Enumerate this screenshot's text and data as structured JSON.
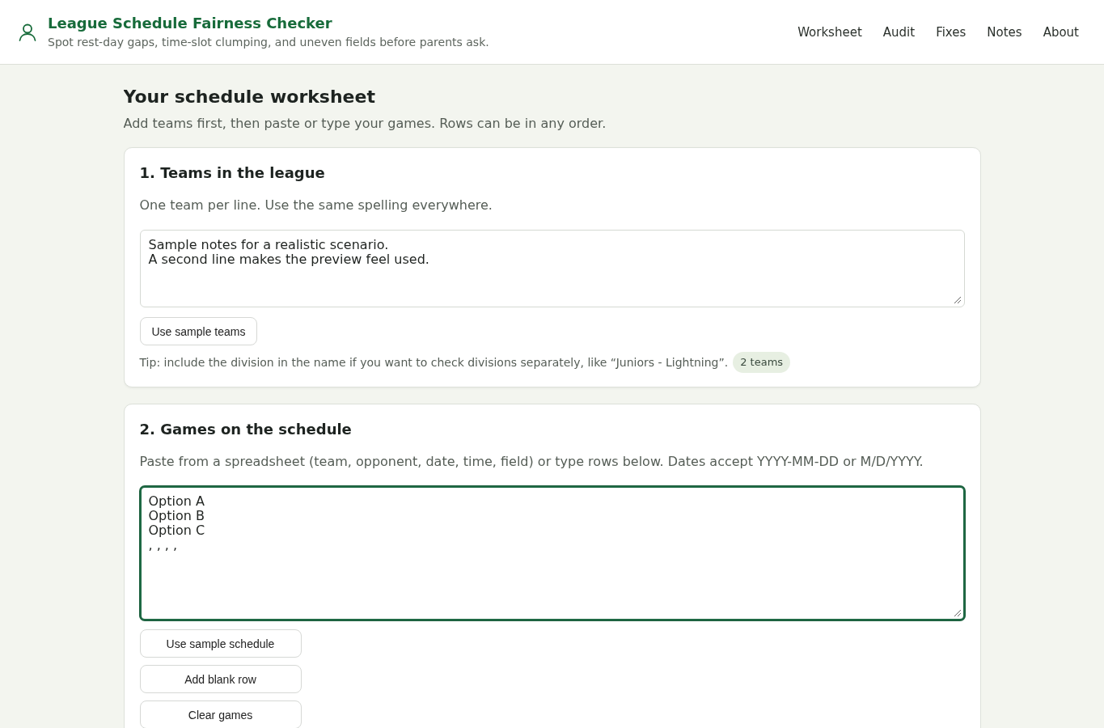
{
  "header": {
    "title": "League Schedule Fairness Checker",
    "subtitle": "Spot rest-day gaps, time-slot clumping, and uneven fields before parents ask.",
    "nav": [
      "Worksheet",
      "Audit",
      "Fixes",
      "Notes",
      "About"
    ]
  },
  "page": {
    "title": "Your schedule worksheet",
    "intro": "Add teams first, then paste or type your games. Rows can be in any order."
  },
  "sections": [
    {
      "title": "1. Teams in the league",
      "description": "One team per line. Use the same spelling everywhere.",
      "input": {
        "value": "Sample notes for a realistic scenario.\nA second line makes the preview feel used.",
        "focused": false
      },
      "buttons": [
        "Use sample teams"
      ],
      "tip": "Tip: include the division in the name if you want to check divisions separately, like “Juniors - Lightning”.",
      "badge": "2 teams"
    },
    {
      "title": "2. Games on the schedule",
      "description": "Paste from a spreadsheet (team, opponent, date, time, field) or type rows below. Dates accept YYYY-MM-DD or M/D/YYYY.",
      "input": {
        "value": "Option A\nOption B\nOption C\n, , , ,",
        "focused": true
      },
      "buttons": [
        "Use sample schedule",
        "Add blank row",
        "Clear games"
      ]
    }
  ]
}
